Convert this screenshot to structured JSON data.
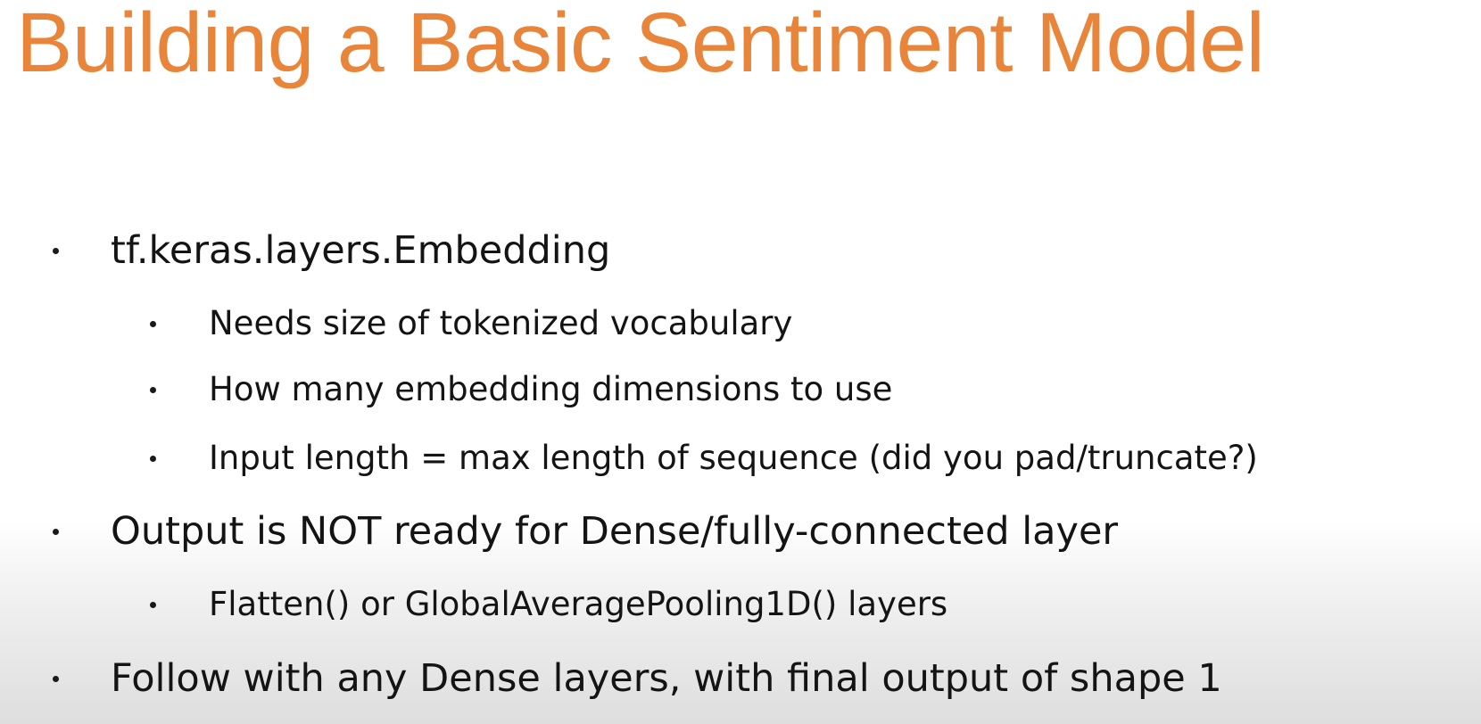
{
  "slide": {
    "title": "Building a Basic Sentiment Model",
    "bullets": [
      {
        "text": "tf.keras.layers.Embedding",
        "sub": [
          "Needs size of tokenized vocabulary",
          "How many embedding dimensions to use",
          "Input length = max length of sequence (did you pad/truncate?)"
        ]
      },
      {
        "text": "Output is NOT ready for Dense/fully-connected layer",
        "sub": [
          "Flatten() or GlobalAveragePooling1D() layers"
        ]
      },
      {
        "text": "Follow with any Dense layers, with final output of shape 1",
        "sub": []
      }
    ]
  },
  "colors": {
    "title": "#e8853a",
    "text": "#141414"
  }
}
